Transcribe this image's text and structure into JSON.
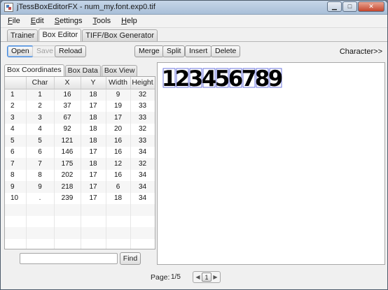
{
  "window": {
    "title": "jTessBoxEditorFX - num_my.font.exp0.tif",
    "minimize_glyph": "▁",
    "maximize_glyph": "□",
    "close_glyph": "✕"
  },
  "menu": [
    {
      "underline": "F",
      "rest": "ile"
    },
    {
      "underline": "E",
      "rest": "dit"
    },
    {
      "underline": "S",
      "rest": "ettings"
    },
    {
      "underline": "T",
      "rest": "ools"
    },
    {
      "underline": "H",
      "rest": "elp"
    }
  ],
  "tabs": [
    "Trainer",
    "Box Editor",
    "TIFF/Box Generator"
  ],
  "toolbar": {
    "open": "Open",
    "save": "Save",
    "reload": "Reload",
    "merge": "Merge",
    "split": "Split",
    "insert": "Insert",
    "delete": "Delete",
    "character": "Character>>"
  },
  "subtabs": [
    "Box Coordinates",
    "Box Data",
    "Box View"
  ],
  "table": {
    "headers": [
      "",
      "Char",
      "X",
      "Y",
      "Width",
      "Height"
    ],
    "rows": [
      [
        "1",
        "1",
        "16",
        "18",
        "9",
        "32"
      ],
      [
        "2",
        "2",
        "37",
        "17",
        "19",
        "33"
      ],
      [
        "3",
        "3",
        "67",
        "18",
        "17",
        "33"
      ],
      [
        "4",
        "4",
        "92",
        "18",
        "20",
        "32"
      ],
      [
        "5",
        "5",
        "121",
        "18",
        "16",
        "33"
      ],
      [
        "6",
        "6",
        "146",
        "17",
        "16",
        "34"
      ],
      [
        "7",
        "7",
        "175",
        "18",
        "12",
        "32"
      ],
      [
        "8",
        "8",
        "202",
        "17",
        "16",
        "34"
      ],
      [
        "9",
        "9",
        "218",
        "17",
        "6",
        "34"
      ],
      [
        "10",
        ".",
        "239",
        "17",
        "18",
        "34"
      ]
    ]
  },
  "find": {
    "button": "Find",
    "value": ""
  },
  "glyphs": [
    "1",
    "2",
    "3",
    "4",
    "5",
    "6",
    "7",
    "8",
    "9"
  ],
  "pager": {
    "label": "Page:",
    "value": "1/5",
    "current": "1",
    "prev": "◀",
    "next": "▶"
  }
}
